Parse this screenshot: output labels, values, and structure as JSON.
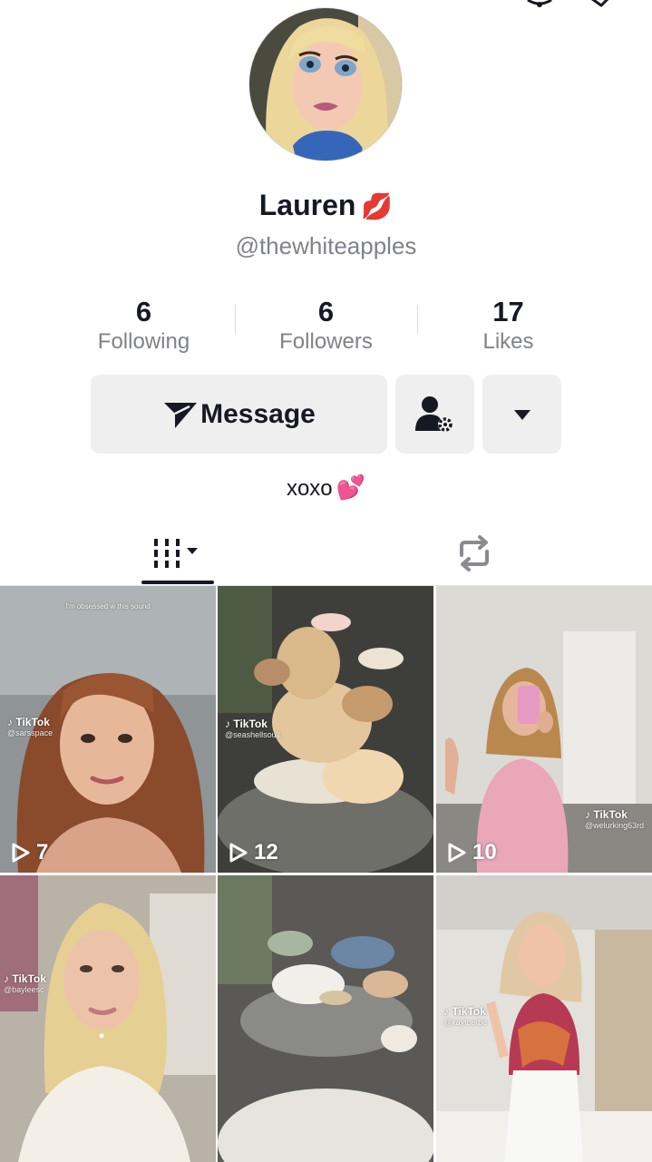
{
  "profile": {
    "display_name": "Lauren",
    "name_emoji": "💋",
    "handle": "@thewhiteapples",
    "bio_text": "xoxo",
    "bio_emoji": "💕"
  },
  "stats": [
    {
      "value": "6",
      "label": "Following"
    },
    {
      "value": "6",
      "label": "Followers"
    },
    {
      "value": "17",
      "label": "Likes"
    }
  ],
  "actions": {
    "message_label": "Message",
    "follow_icon": "add-friend-settings-icon",
    "more_icon": "caret-down-icon"
  },
  "tabs": {
    "videos_icon": "grid-videos-icon",
    "reposts_icon": "repost-icon"
  },
  "videos": [
    {
      "views": "7",
      "caption": "I'm obsessed w this sound",
      "watermark_brand": "TikTok",
      "watermark_user": "@sarsspace"
    },
    {
      "views": "12",
      "watermark_brand": "TikTok",
      "watermark_user": "@seashellsoull"
    },
    {
      "views": "10",
      "watermark_brand": "TikTok",
      "watermark_user": "@welurking63rd"
    },
    {
      "watermark_brand": "TikTok",
      "watermark_user": "@bayleesc"
    },
    {},
    {
      "watermark_brand": "TikTok",
      "watermark_user": "@kaytcerbe"
    }
  ],
  "colors": {
    "text_primary": "#161823",
    "text_secondary": "#80828a",
    "button_bg": "#efefef"
  }
}
